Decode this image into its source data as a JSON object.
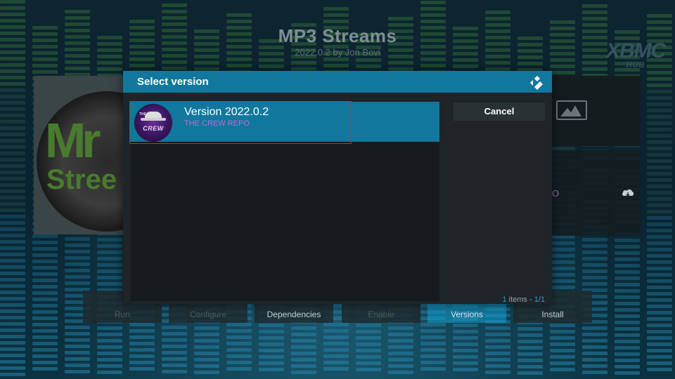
{
  "background": {
    "title": "MP3 Streams",
    "subtitle": "2022.0.2 by Jon Bovi",
    "logo_text": "XBMC",
    "logo_sub": "HUB",
    "thumb_text_line1": "Mr",
    "thumb_text_line2": "Stree",
    "status_char": "O",
    "buttons": [
      {
        "label": "Run"
      },
      {
        "label": "Configure"
      },
      {
        "label": "Dependencies"
      },
      {
        "label": "Enable"
      },
      {
        "label": "Versions"
      },
      {
        "label": "Install"
      }
    ]
  },
  "dialog": {
    "title": "Select version",
    "icon": "kodi-icon",
    "list": [
      {
        "name": "Version 2022.0.2",
        "repo": "THE CREW REPO",
        "thumb_text_small": "THE",
        "thumb_text": "CREW"
      }
    ],
    "cancel_label": "Cancel",
    "count": {
      "items_num": "1",
      "items_word": "items",
      "separator": "-",
      "page": "1/1"
    }
  },
  "colors": {
    "header": "#12779d",
    "selected_item": "#12779d",
    "repo_text": "#b76fd8",
    "highlight_border": "#e2231a",
    "dialog_bg": "#1e2427",
    "count_accent": "#1e9fd6"
  }
}
